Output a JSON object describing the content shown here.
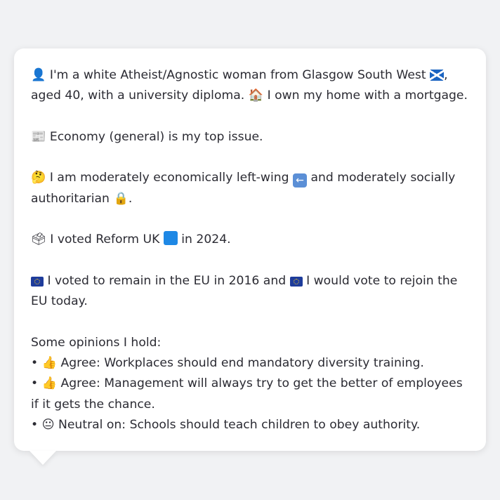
{
  "profile": {
    "intro_icon": "person-silhouette-icon",
    "intro_text_1": "I'm a white Atheist/Agnostic woman from Glasgow South West",
    "intro_flag": "scotland-flag-icon",
    "intro_text_2": ", aged 40, with a university diploma.",
    "home_icon": "house-icon",
    "home_text": "I own my home with a mortgage.",
    "issue_icon": "newspaper-icon",
    "issue_text": "Economy (general) is my top issue.",
    "ideology_icon": "thinking-face-icon",
    "ideology_text_1": "I am moderately economically left-wing",
    "left_arrow_icon": "left-arrow-icon",
    "ideology_text_2": "and moderately socially authoritarian",
    "lock_icon": "lock-icon",
    "ideology_end": ".",
    "vote_icon": "ballot-box-icon",
    "vote_text_1": "I voted Reform UK",
    "party_color_icon": "blue-square-icon",
    "vote_text_2": "in 2024.",
    "eu_icon_1": "eu-flag-icon",
    "eu_text_1": "I voted to remain in the EU in 2016 and",
    "eu_icon_2": "eu-flag-icon",
    "eu_text_2": "I would vote to rejoin the EU today.",
    "opinions_heading": "Some opinions I hold:",
    "opinions": [
      {
        "bullet": "•",
        "emoji": "👍",
        "text": "Agree: Workplaces should end mandatory diversity training."
      },
      {
        "bullet": "•",
        "emoji": "👍",
        "text": "Agree: Management will always try to get the better of employees if it gets the chance."
      },
      {
        "bullet": "•",
        "emoji": "😐",
        "text": "Neutral on: Schools should teach children to obey authority."
      }
    ]
  }
}
